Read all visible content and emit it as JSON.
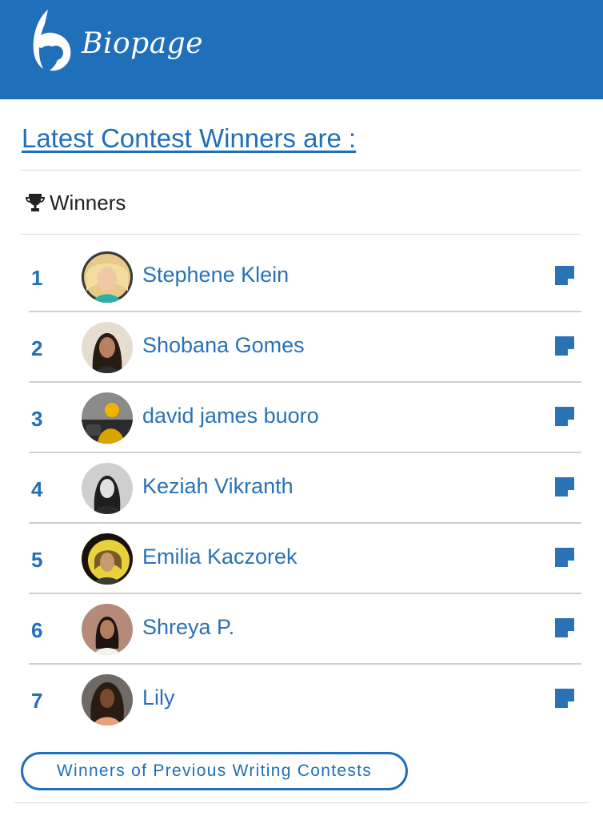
{
  "header": {
    "brand": "Biopage",
    "color": "#1f6fba"
  },
  "title": "Latest Contest Winners are :",
  "winners_section": {
    "icon": "trophy-icon",
    "label": "Winners"
  },
  "winners": [
    {
      "rank": "1",
      "name": "Stephene Klein"
    },
    {
      "rank": "2",
      "name": "Shobana Gomes"
    },
    {
      "rank": "3",
      "name": "david james buoro"
    },
    {
      "rank": "4",
      "name": "Keziah Vikranth"
    },
    {
      "rank": "5",
      "name": "Emilia Kaczorek"
    },
    {
      "rank": "6",
      "name": "Shreya P."
    },
    {
      "rank": "7",
      "name": "Lily"
    }
  ],
  "row_icon": "note-icon",
  "previous_button": "Winners of Previous Writing Contests"
}
